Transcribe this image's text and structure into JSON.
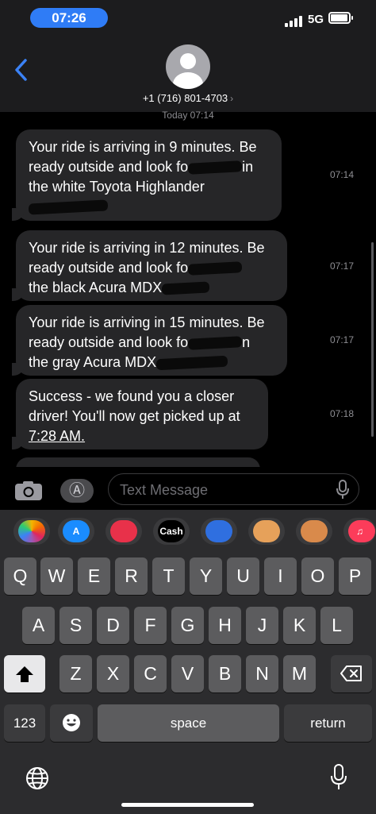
{
  "status_bar": {
    "time": "07:26",
    "network": "5G"
  },
  "contact": {
    "number": "+1 (716) 801-4703",
    "chevron": "›"
  },
  "thread": {
    "day_label": "Today 07:14",
    "messages": [
      {
        "line1": "Your ride is arriving in 9 minutes. Be",
        "line2a": "ready outside and look fo",
        "line2b": "in",
        "line3": "the white Toyota Highlander",
        "time": "07:14"
      },
      {
        "line1": "Your ride is arriving in 12 minutes. Be",
        "line2a": "ready outside and look fo",
        "line2b": "",
        "line3": "the black Acura MDX",
        "time": "07:17"
      },
      {
        "line1": "Your ride is arriving in 15 minutes. Be",
        "line2a": "ready outside and look fo",
        "line2b": "n",
        "line3": "the gray Acura MDX",
        "time": "07:17"
      },
      {
        "line1": "Success - we found you a closer",
        "line2a": "driver! You'll now get picked up at",
        "line2b": "",
        "line3": "7:28 AM.",
        "time": "07:18"
      }
    ]
  },
  "composer": {
    "placeholder": "Text Message",
    "apps_glyph": "Ⓐ"
  },
  "app_strip": {
    "items": [
      {
        "name": "photos",
        "label": ""
      },
      {
        "name": "app-store",
        "label": "A"
      },
      {
        "name": "images-search",
        "label": ""
      },
      {
        "name": "apple-cash",
        "label": "Cash"
      },
      {
        "name": "audio-message",
        "label": ""
      },
      {
        "name": "memoji-1",
        "label": ""
      },
      {
        "name": "memoji-2",
        "label": ""
      },
      {
        "name": "music",
        "label": "♫"
      }
    ]
  },
  "keyboard": {
    "row1": [
      "Q",
      "W",
      "E",
      "R",
      "T",
      "Y",
      "U",
      "I",
      "O",
      "P"
    ],
    "row2": [
      "A",
      "S",
      "D",
      "F",
      "G",
      "H",
      "J",
      "K",
      "L"
    ],
    "row3": [
      "Z",
      "X",
      "C",
      "V",
      "B",
      "N",
      "M"
    ],
    "numbers_label": "123",
    "space_label": "space",
    "return_label": "return"
  },
  "colors": {
    "accent": "#2f7cf6",
    "bubble": "#262628",
    "keyboard": "#2c2c2e"
  }
}
